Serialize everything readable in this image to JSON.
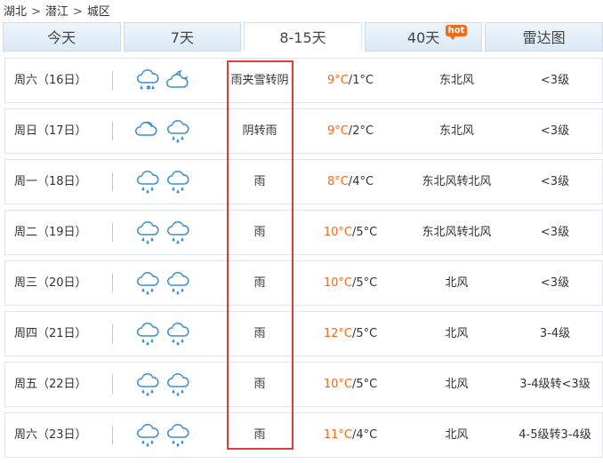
{
  "breadcrumb": {
    "items": [
      "湖北",
      "潜江",
      "城区"
    ],
    "separator": ">"
  },
  "tabs": [
    {
      "label": "今天",
      "active": false
    },
    {
      "label": "7天",
      "active": false
    },
    {
      "label": "8-15天",
      "active": true
    },
    {
      "label": "40天",
      "active": false,
      "badge": "hot"
    },
    {
      "label": "雷达图",
      "active": false
    }
  ],
  "colors": {
    "temp_high": "#f06a18",
    "highlight_border": "#e23a3a",
    "tab_bg": "#dbe9f5",
    "row_border": "#dde6ee"
  },
  "forecast": [
    {
      "day": "周六（16日）",
      "icons": [
        "rain-snow-icon",
        "partly-cloudy-night-icon"
      ],
      "weather": "雨夹雪转阴",
      "high": "9°C",
      "low": "1°C",
      "wind": "东北风",
      "level": "<3级"
    },
    {
      "day": "周日（17日）",
      "icons": [
        "cloudy-icon",
        "rain-icon"
      ],
      "weather": "阴转雨",
      "high": "9°C",
      "low": "2°C",
      "wind": "东北风",
      "level": "<3级"
    },
    {
      "day": "周一（18日）",
      "icons": [
        "rain-icon",
        "rain-icon"
      ],
      "weather": "雨",
      "high": "8°C",
      "low": "4°C",
      "wind": "东北风转北风",
      "level": "<3级"
    },
    {
      "day": "周二（19日）",
      "icons": [
        "rain-icon",
        "rain-icon"
      ],
      "weather": "雨",
      "high": "10°C",
      "low": "5°C",
      "wind": "东北风转北风",
      "level": "<3级"
    },
    {
      "day": "周三（20日）",
      "icons": [
        "rain-icon",
        "rain-icon"
      ],
      "weather": "雨",
      "high": "10°C",
      "low": "5°C",
      "wind": "北风",
      "level": "<3级"
    },
    {
      "day": "周四（21日）",
      "icons": [
        "rain-icon",
        "rain-icon"
      ],
      "weather": "雨",
      "high": "12°C",
      "low": "5°C",
      "wind": "北风",
      "level": "3-4级"
    },
    {
      "day": "周五（22日）",
      "icons": [
        "rain-icon",
        "rain-icon"
      ],
      "weather": "雨",
      "high": "10°C",
      "low": "5°C",
      "wind": "北风",
      "level": "3-4级转<3级"
    },
    {
      "day": "周六（23日）",
      "icons": [
        "rain-icon",
        "rain-icon"
      ],
      "weather": "雨",
      "high": "11°C",
      "low": "4°C",
      "wind": "北风",
      "level": "4-5级转3-4级"
    }
  ]
}
